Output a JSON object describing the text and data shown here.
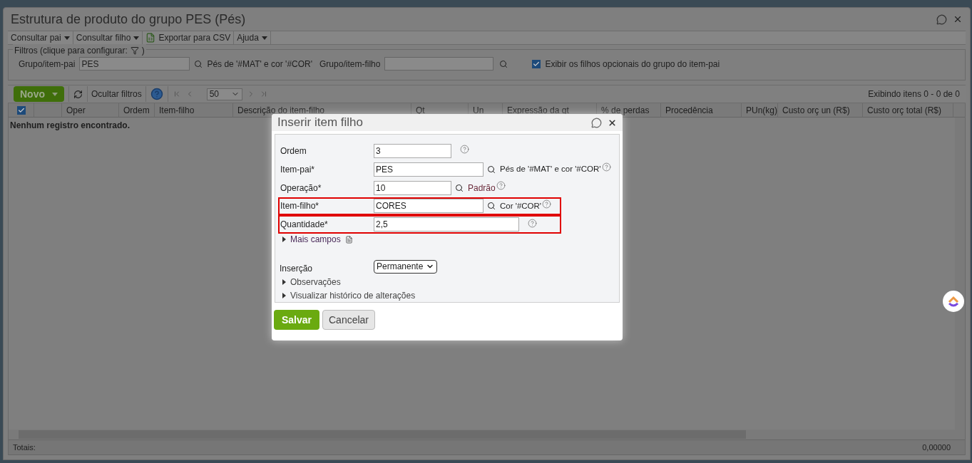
{
  "window": {
    "title": "Estrutura de produto do grupo PES (Pés)"
  },
  "menu": [
    {
      "label": "Consultar pai",
      "kind": "dropdown"
    },
    {
      "label": "Consultar filho",
      "kind": "dropdown"
    },
    {
      "label": "Exportar para CSV",
      "kind": "export"
    },
    {
      "label": "Ajuda",
      "kind": "dropdown"
    }
  ],
  "filters": {
    "legend": "Filtros (clique para configurar:",
    "legend_end": ")",
    "parent_label": "Grupo/item-pai",
    "parent_value": "PES",
    "parent_desc": "Pés de '#MAT' e cor '#COR'",
    "child_label": "Grupo/item-filho",
    "show_optional": {
      "label": "Exibir os filhos opcionais do grupo do item-pai",
      "checked": true
    }
  },
  "toolbar": {
    "new_button": "Novo",
    "hide_filters": "Ocultar filtros",
    "page_size": "50",
    "range": "Exibindo itens 0 - 0 de 0"
  },
  "table": {
    "select_all_checked": true,
    "columns": [
      "",
      "Oper",
      "Ordem",
      "Item-filho",
      "Descrição do item-filho",
      "Qt",
      "Un",
      "Expressão da qt",
      "% de perdas",
      "Procedência",
      "PUn(kg)",
      "Custo orç un (R$)",
      "Custo orç total (R$)"
    ],
    "empty": "Nenhum registro encontrado.",
    "totals_label": "Totais:",
    "totals_value": "0,00000"
  },
  "dialog": {
    "title": "Inserir item filho",
    "fields": [
      {
        "label": "Ordem",
        "value": "3",
        "search": false,
        "highlighted": false
      },
      {
        "label": "Item-pai*",
        "value": "PES",
        "search": true,
        "desc": "Pés de '#MAT' e cor '#COR'",
        "highlighted": false
      },
      {
        "label": "Operação*",
        "value": "10",
        "search": true,
        "link": "Padrão",
        "highlighted": false
      },
      {
        "label": "Item-filho*",
        "value": "CORES",
        "search": true,
        "desc": "Cor '#COR'",
        "highlighted": true
      },
      {
        "label": "Quantidade*",
        "value": "2,5",
        "search": false,
        "highlighted": true
      }
    ],
    "more_fields": "Mais campos",
    "insertion_label": "Inserção",
    "insertion_value": "Permanente",
    "sections": [
      "Observações",
      "Visualizar histórico de alterações"
    ],
    "save": "Salvar",
    "cancel": "Cancelar"
  }
}
